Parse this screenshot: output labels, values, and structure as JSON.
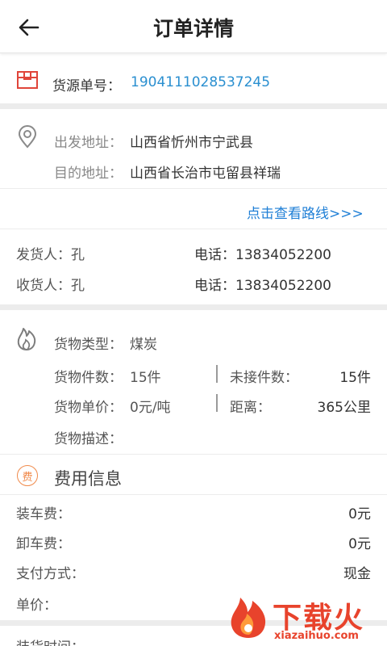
{
  "header": {
    "title": "订单详情",
    "back_icon": "arrow-left-icon"
  },
  "source": {
    "label": "货源单号：",
    "value": "1904111028537245"
  },
  "address": {
    "from_label": "出发地址：",
    "from_value": "山西省忻州市宁武县",
    "to_label": "目的地址：",
    "to_value": "山西省长治市屯留县祥瑞",
    "route_link": "点击查看路线>>>"
  },
  "contacts": {
    "shipper_label": "发货人：孔",
    "shipper_phone": "电话：13834052200",
    "receiver_label": "收货人：孔",
    "receiver_phone": "电话：13834052200"
  },
  "goods": {
    "type_label": "货物类型：",
    "type_value": "煤炭",
    "count_label": "货物件数：",
    "count_value": "15件",
    "unreceived_label": "未接件数：",
    "unreceived_value": "15件",
    "price_label": "货物单价：",
    "price_value": "0元/吨",
    "distance_label": "距离：",
    "distance_value": "365公里",
    "desc_label": "货物描述："
  },
  "fees": {
    "icon_char": "费",
    "title": "费用信息",
    "items": [
      {
        "label": "装车费：",
        "value": "0元"
      },
      {
        "label": "卸车费：",
        "value": "0元"
      },
      {
        "label": "支付方式：",
        "value": "现金"
      },
      {
        "label": "单价：",
        "value": ""
      }
    ],
    "next_label": "装货时间："
  },
  "watermark": {
    "brand": "下载火",
    "domain": "xiazaihuo.com"
  },
  "colors": {
    "accent_blue": "#2a8fd0",
    "link_blue": "#1f7fd6",
    "fee_orange": "#f08a4b",
    "watermark_red": "#e8432c"
  }
}
